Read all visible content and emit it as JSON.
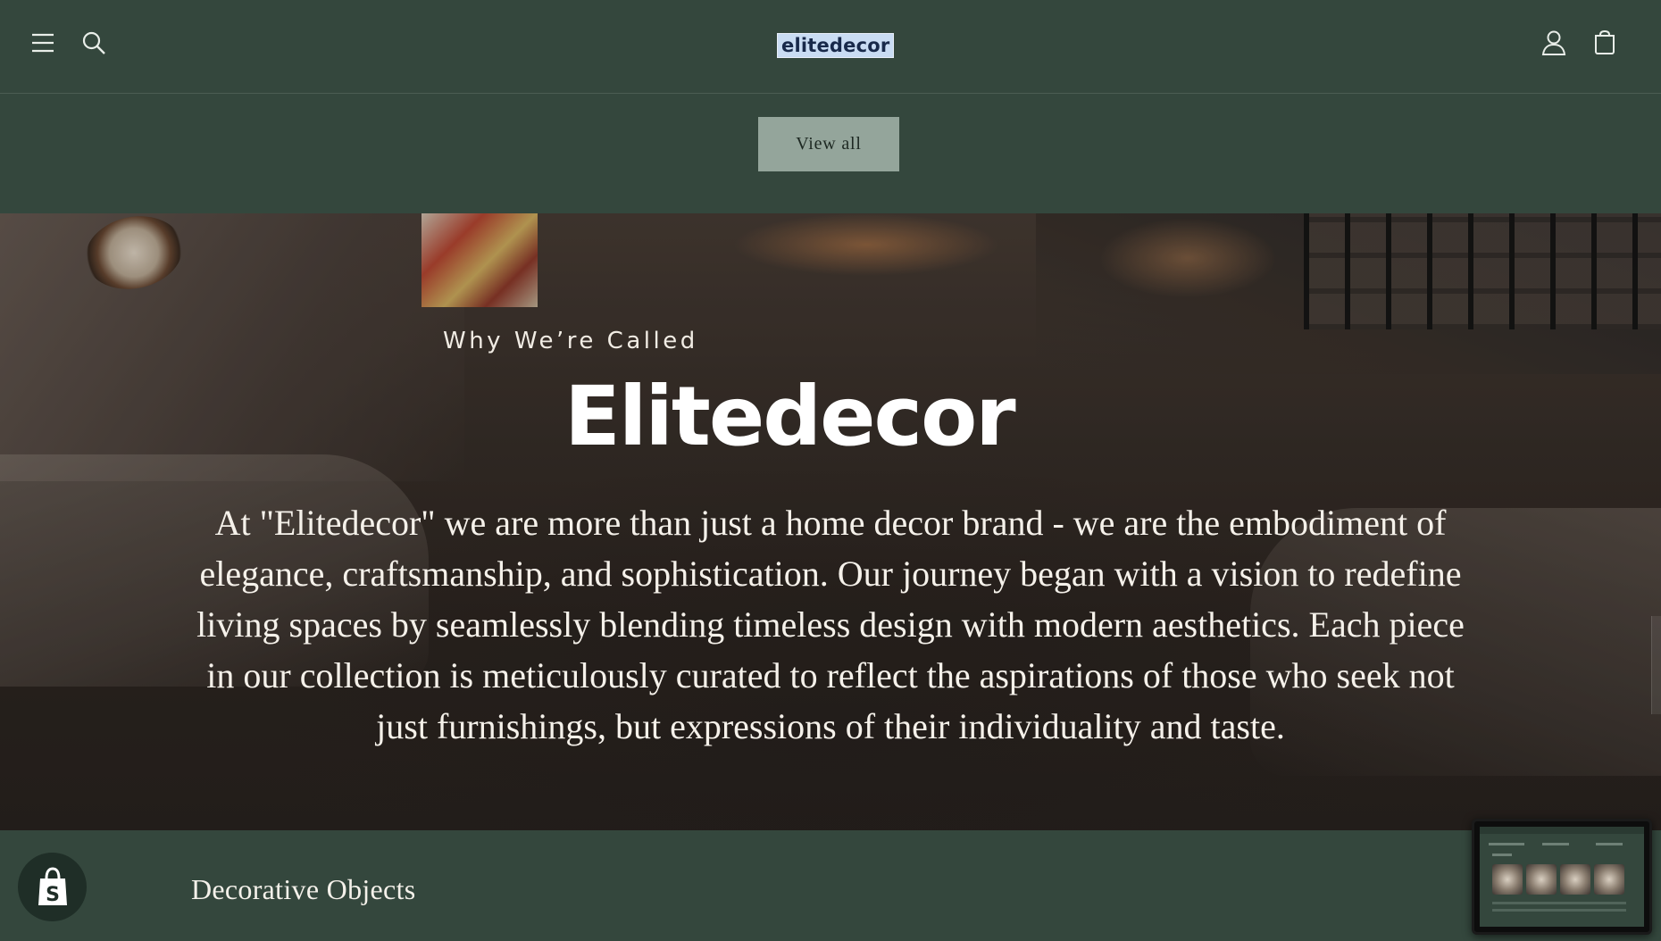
{
  "header": {
    "logo_text": "elitedecor",
    "menu_icon": "hamburger-menu-icon",
    "search_icon": "search-icon",
    "account_icon": "account-icon",
    "cart_icon": "cart-icon"
  },
  "collection": {
    "view_all_label": "View all"
  },
  "hero": {
    "kicker": "Why We’re Called",
    "title": "Elitedecor",
    "body": "At \"Elitedecor\" we are more than just a home decor brand - we are the embodiment of elegance, craftsmanship, and sophistication. Our journey began with a vision to redefine living spaces by seamlessly blending timeless design with modern aesthetics. Each piece in our collection is meticulously curated to reflect the aspirations of those who seek not just furnishings, but expressions of their individuality and taste."
  },
  "next_section": {
    "title": "Decorative Objects"
  },
  "widgets": {
    "shop_badge_icon": "shopify-bag-icon",
    "preview_icon": "page-preview-thumbnail"
  },
  "colors": {
    "background": "#34473d",
    "button_bg": "#94a59b",
    "logo_bg": "#c9dcf3",
    "text_light": "#f2efe9"
  }
}
